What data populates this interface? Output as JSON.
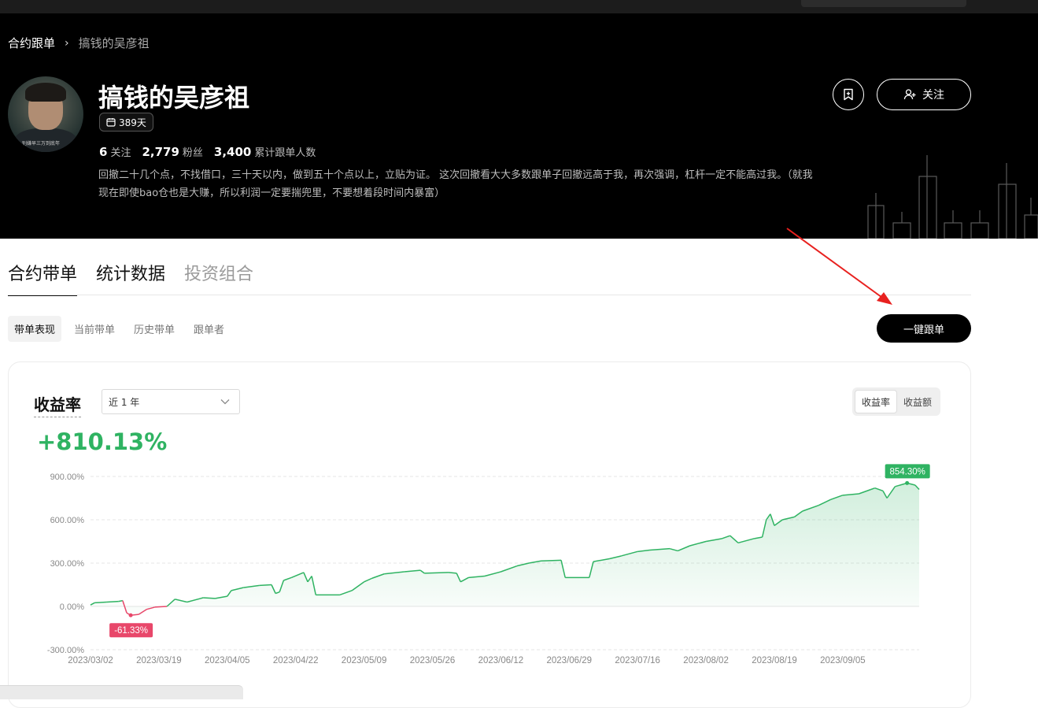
{
  "breadcrumb": {
    "parent": "合约跟单",
    "separator": "›",
    "current": "搞钱的吴彦祖"
  },
  "profile": {
    "name": "搞钱的吴彦祖",
    "avatar_caption": "别嫌早三万到底年",
    "days": "389天",
    "following_count": "6",
    "following_label": "关注",
    "fans_count": "2,779",
    "fans_label": "粉丝",
    "copiers_count": "3,400",
    "copiers_label": "累计跟单人数",
    "bio": "回撤二十几个点，不找借口，三十天以内，做到五十个点以上，立贴为证。 这次回撤看大大多数跟单子回撤远高于我，再次强调，杠杆一定不能高过我。（就我现在即使bao仓也是大赚，所以利润一定要揣兜里，不要想着段时间内暴富）"
  },
  "actions": {
    "follow_label": "关注",
    "copy_label": "一键跟单"
  },
  "tabs": [
    "合约带单",
    "统计数据",
    "投资组合"
  ],
  "subtabs": [
    "带单表现",
    "当前带单",
    "历史带单",
    "跟单者"
  ],
  "card": {
    "metric_title": "收益率",
    "range": "近 1 年",
    "toggle": [
      "收益率",
      "收益额"
    ],
    "value": "+810.13%"
  },
  "colors": {
    "positive": "#2fb362",
    "negative": "#e8476a",
    "hero_bg": "#000000"
  },
  "chart_data": {
    "type": "area",
    "y_ticks": [
      "900.00%",
      "600.00%",
      "300.00%",
      "0.00%",
      "-300.00%"
    ],
    "ylim": [
      -300,
      900
    ],
    "x_ticks": [
      "2023/03/02",
      "2023/03/19",
      "2023/04/05",
      "2023/04/22",
      "2023/05/09",
      "2023/05/26",
      "2023/06/12",
      "2023/06/29",
      "2023/07/16",
      "2023/08/02",
      "2023/08/19",
      "2023/09/05"
    ],
    "max_label": "854.30%",
    "min_label": "-61.33%",
    "series": [
      {
        "points": [
          [
            "2023/03/02",
            10
          ],
          [
            "2023/03/03",
            25
          ],
          [
            "2023/03/06",
            30
          ],
          [
            "2023/03/09",
            35
          ],
          [
            "2023/03/10",
            40
          ],
          [
            "2023/03/11",
            -45
          ],
          [
            "2023/03/12",
            -61.33
          ],
          [
            "2023/03/14",
            -55
          ],
          [
            "2023/03/16",
            -20
          ],
          [
            "2023/03/18",
            -5
          ],
          [
            "2023/03/21",
            0
          ],
          [
            "2023/03/23",
            50
          ],
          [
            "2023/03/26",
            30
          ],
          [
            "2023/03/30",
            60
          ],
          [
            "2023/04/02",
            55
          ],
          [
            "2023/04/05",
            70
          ],
          [
            "2023/04/06",
            110
          ],
          [
            "2023/04/09",
            130
          ],
          [
            "2023/04/13",
            145
          ],
          [
            "2023/04/16",
            150
          ],
          [
            "2023/04/17",
            90
          ],
          [
            "2023/04/18",
            100
          ],
          [
            "2023/04/19",
            180
          ],
          [
            "2023/04/21",
            200
          ],
          [
            "2023/04/24",
            235
          ],
          [
            "2023/04/25",
            170
          ],
          [
            "2023/04/26",
            210
          ],
          [
            "2023/04/27",
            80
          ],
          [
            "2023/05/03",
            80
          ],
          [
            "2023/05/06",
            110
          ],
          [
            "2023/05/09",
            170
          ],
          [
            "2023/05/11",
            195
          ],
          [
            "2023/05/14",
            225
          ],
          [
            "2023/05/19",
            240
          ],
          [
            "2023/05/23",
            250
          ],
          [
            "2023/05/24",
            230
          ],
          [
            "2023/05/30",
            235
          ],
          [
            "2023/06/01",
            230
          ],
          [
            "2023/06/02",
            170
          ],
          [
            "2023/06/04",
            200
          ],
          [
            "2023/06/08",
            210
          ],
          [
            "2023/06/12",
            240
          ],
          [
            "2023/06/16",
            280
          ],
          [
            "2023/06/19",
            300
          ],
          [
            "2023/06/22",
            315
          ],
          [
            "2023/06/27",
            320
          ],
          [
            "2023/06/28",
            200
          ],
          [
            "2023/07/04",
            200
          ],
          [
            "2023/07/05",
            310
          ],
          [
            "2023/07/09",
            330
          ],
          [
            "2023/07/12",
            350
          ],
          [
            "2023/07/16",
            380
          ],
          [
            "2023/07/19",
            390
          ],
          [
            "2023/07/24",
            400
          ],
          [
            "2023/07/26",
            385
          ],
          [
            "2023/07/29",
            420
          ],
          [
            "2023/08/02",
            450
          ],
          [
            "2023/08/06",
            470
          ],
          [
            "2023/08/08",
            490
          ],
          [
            "2023/08/10",
            440
          ],
          [
            "2023/08/14",
            470
          ],
          [
            "2023/08/16",
            480
          ],
          [
            "2023/08/17",
            600
          ],
          [
            "2023/08/18",
            640
          ],
          [
            "2023/08/19",
            560
          ],
          [
            "2023/08/21",
            600
          ],
          [
            "2023/08/24",
            620
          ],
          [
            "2023/08/26",
            660
          ],
          [
            "2023/08/30",
            700
          ],
          [
            "2023/09/02",
            740
          ],
          [
            "2023/09/05",
            770
          ],
          [
            "2023/09/09",
            780
          ],
          [
            "2023/09/12",
            810
          ],
          [
            "2023/09/13",
            820
          ],
          [
            "2023/09/15",
            800
          ],
          [
            "2023/09/16",
            750
          ],
          [
            "2023/09/18",
            830
          ],
          [
            "2023/09/21",
            854.3
          ],
          [
            "2023/09/23",
            840
          ],
          [
            "2023/09/24",
            810
          ]
        ]
      }
    ],
    "grid": true
  }
}
